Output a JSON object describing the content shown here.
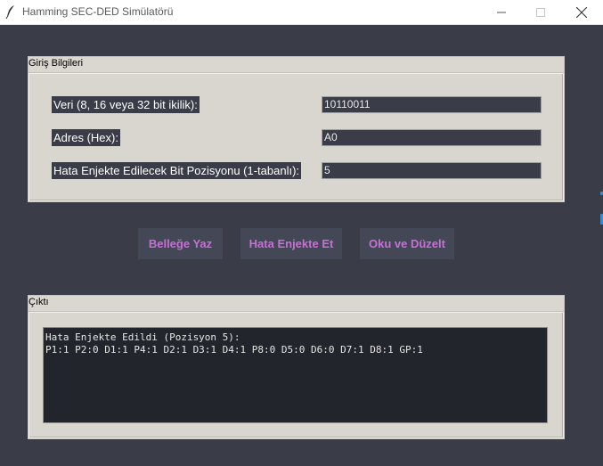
{
  "window": {
    "title": "Hamming SEC-DED Simülatörü",
    "icons": [
      "feather-icon",
      "minimize-icon",
      "maximize-icon",
      "close-icon"
    ]
  },
  "input_frame": {
    "title": "Giriş Bilgileri",
    "fields": [
      {
        "label": "Veri (8, 16 veya 32 bit ikilik):",
        "value": "10110011"
      },
      {
        "label": "Adres (Hex):",
        "value": "A0"
      },
      {
        "label": "Hata Enjekte Edilecek Bit Pozisyonu (1-tabanlı):",
        "value": "5"
      }
    ]
  },
  "buttons": {
    "write": "Belleğe Yaz",
    "inject": "Hata Enjekte Et",
    "read": "Oku ve Düzelt"
  },
  "output_frame": {
    "title": "Çıktı",
    "lines": [
      "Hata Enjekte Edildi (Pozisyon 5):",
      "P1:1 P2:0 D1:1 P4:1 D2:1 D3:1 D4:1 P8:0 D5:0 D6:0 D7:1 D8:1 GP:1"
    ]
  },
  "colors": {
    "background": "#3a3d47",
    "frame": "#d9d6d0",
    "button_bg": "#444856",
    "button_text": "#c86fd6",
    "output_bg": "#23252c"
  }
}
